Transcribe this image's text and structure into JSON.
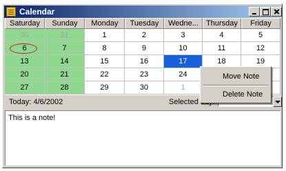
{
  "window": {
    "title": "Calendar"
  },
  "titlebar": {
    "buttons": [
      "minimize",
      "maximize",
      "close"
    ]
  },
  "calendar": {
    "headers": [
      "Saturday",
      "Sunday",
      "Monday",
      "Tuesday",
      "Wedne...",
      "Thursday",
      "Friday"
    ],
    "weeks": [
      [
        "30",
        "31",
        "1",
        "2",
        "3",
        "4",
        "5"
      ],
      [
        "6",
        "7",
        "8",
        "9",
        "10",
        "11",
        "12"
      ],
      [
        "13",
        "14",
        "15",
        "16",
        "17",
        "18",
        "19"
      ],
      [
        "20",
        "21",
        "22",
        "23",
        "24",
        "25",
        "26"
      ],
      [
        "27",
        "28",
        "29",
        "30",
        "1",
        "2",
        "3"
      ]
    ],
    "colors": {
      "weekend": "#90d890",
      "selected": "#1860d8",
      "today_marker": "#c02020"
    }
  },
  "status": {
    "today": "Today: 4/6/2002",
    "selected_label": "Selected day:",
    "selected_value": "4/17/2002"
  },
  "note": {
    "text": "This is a note!"
  },
  "context_menu": {
    "move": "Move Note",
    "delete": "Delete Note"
  }
}
